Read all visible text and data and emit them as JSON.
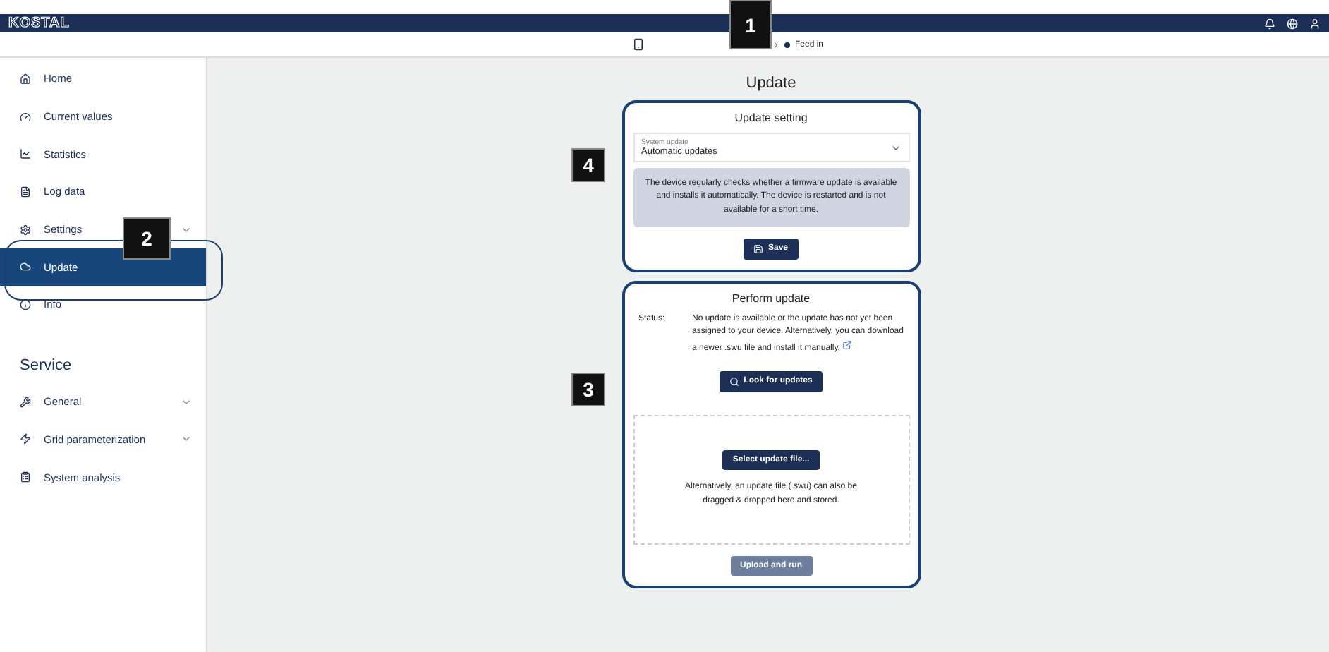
{
  "header": {
    "logo": "KOSTAL",
    "status": "Feed in"
  },
  "sidebar": {
    "items": [
      {
        "label": "Home",
        "selected": false,
        "expandable": false
      },
      {
        "label": "Current values",
        "selected": false,
        "expandable": false
      },
      {
        "label": "Statistics",
        "selected": false,
        "expandable": false
      },
      {
        "label": "Log data",
        "selected": false,
        "expandable": false
      },
      {
        "label": "Settings",
        "selected": false,
        "expandable": true
      },
      {
        "label": "Update",
        "selected": true,
        "expandable": false
      },
      {
        "label": "Info",
        "selected": false,
        "expandable": false
      }
    ],
    "service_heading": "Service",
    "service_items": [
      {
        "label": "General",
        "selected": false,
        "expandable": true
      },
      {
        "label": "Grid parameterization",
        "selected": false,
        "expandable": true
      },
      {
        "label": "System analysis",
        "selected": false,
        "expandable": false
      }
    ]
  },
  "page_title": "Update",
  "update_setting": {
    "title": "Update setting",
    "field_label": "System update",
    "field_value": "Automatic updates",
    "info": "The device regularly checks whether a firmware update is available and installs it automatically. The device is restarted and is not available for a short time.",
    "save": "Save"
  },
  "perform_update": {
    "title": "Perform update",
    "status_label": "Status:",
    "status_text": "No update is available or the update has not yet been assigned to your device. Alternatively, you can download a newer .swu file and install it manually.",
    "look_button": "Look for updates",
    "select_button": "Select update file...",
    "drop_hint": "Alternatively, an update file (.swu) can also be dragged & dropped here and stored.",
    "upload_button": "Upload and run",
    "upload_disabled": true
  },
  "callouts": [
    "1",
    "2",
    "3",
    "4"
  ]
}
